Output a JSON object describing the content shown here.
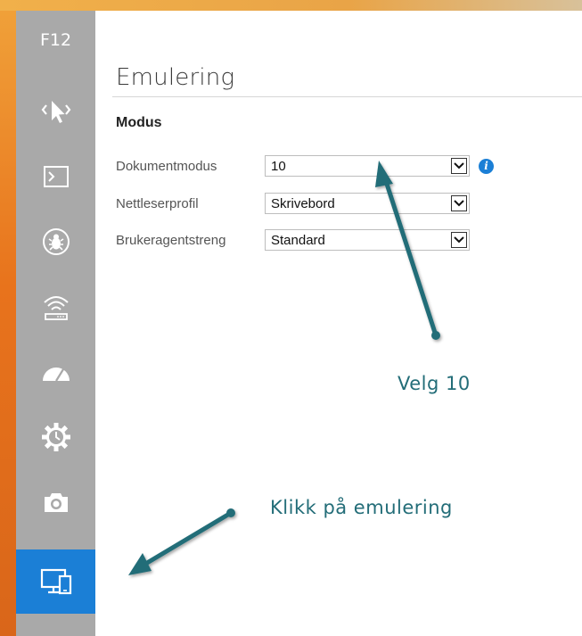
{
  "devtools": {
    "shortcut_label": "F12",
    "tools": [
      {
        "name": "dom-explorer",
        "icon": "pointer-select-icon"
      },
      {
        "name": "console",
        "icon": "console-icon"
      },
      {
        "name": "debugger",
        "icon": "bug-icon"
      },
      {
        "name": "network",
        "icon": "wifi-router-icon"
      },
      {
        "name": "performance",
        "icon": "speedometer-icon"
      },
      {
        "name": "memory",
        "icon": "gear-clock-icon"
      },
      {
        "name": "profiler",
        "icon": "camera-icon"
      },
      {
        "name": "emulation",
        "icon": "devices-icon",
        "active": true
      }
    ],
    "accent_color": "#1b7fd6",
    "toolbar_color": "#a9a9a9"
  },
  "panel": {
    "title": "Emulering",
    "section": "Modus",
    "rows": [
      {
        "label": "Dokumentmodus",
        "value": "10",
        "info": true
      },
      {
        "label": "Nettleserprofil",
        "value": "Skrivebord"
      },
      {
        "label": "Brukeragentstreng",
        "value": "Standard"
      }
    ],
    "info_glyph": "i"
  },
  "annotations": {
    "select_hint": "Velg 10",
    "click_hint": "Klikk på emulering",
    "arrow_color": "#236d78"
  }
}
